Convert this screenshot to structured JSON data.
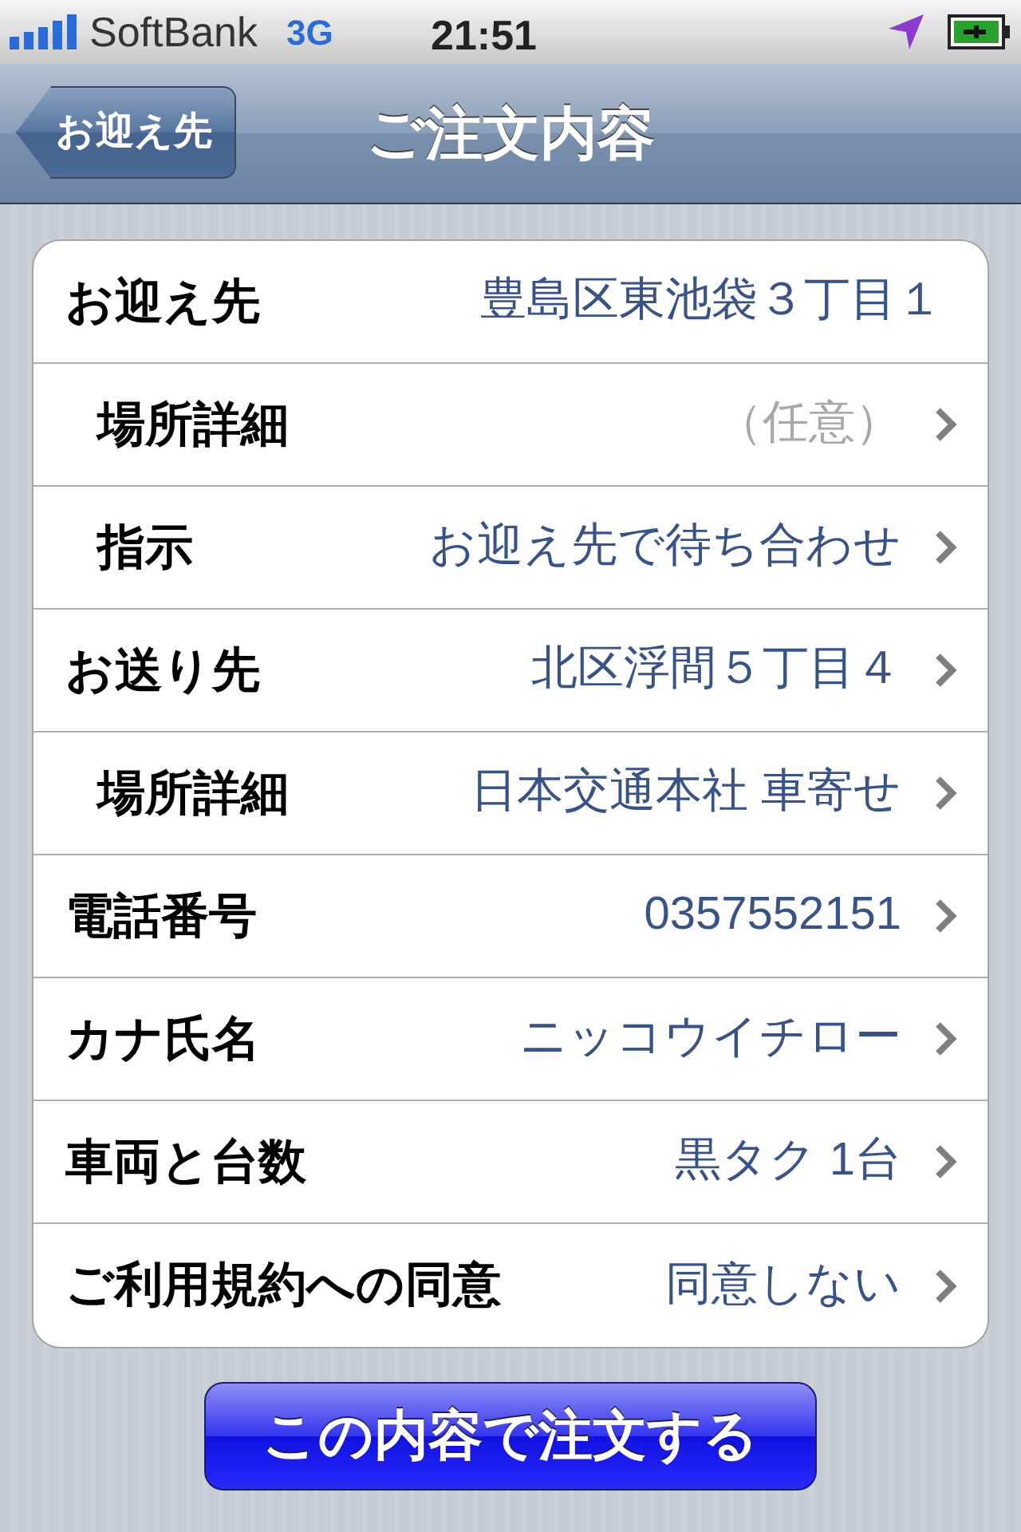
{
  "status_bar": {
    "carrier": "SoftBank",
    "network": "3G",
    "time": "21:51"
  },
  "nav_bar": {
    "back_button": "お迎え先",
    "title": "ご注文内容"
  },
  "rows": [
    {
      "label": "お迎え先",
      "value": "豊島区東池袋３丁目１",
      "indented": false,
      "disclosure": false,
      "placeholder": false
    },
    {
      "label": "場所詳細",
      "value": "（任意）",
      "indented": true,
      "disclosure": true,
      "placeholder": true
    },
    {
      "label": "指示",
      "value": "お迎え先で待ち合わせ",
      "indented": true,
      "disclosure": true,
      "placeholder": false
    },
    {
      "label": "お送り先",
      "value": "北区浮間５丁目４",
      "indented": false,
      "disclosure": true,
      "placeholder": false
    },
    {
      "label": "場所詳細",
      "value": "日本交通本社 車寄せ",
      "indented": true,
      "disclosure": true,
      "placeholder": false
    },
    {
      "label": "電話番号",
      "value": "0357552151",
      "indented": false,
      "disclosure": true,
      "placeholder": false
    },
    {
      "label": "カナ氏名",
      "value": "ニッコウイチロー",
      "indented": false,
      "disclosure": true,
      "placeholder": false
    },
    {
      "label": "車両と台数",
      "value": "黒タク 1台",
      "indented": false,
      "disclosure": true,
      "placeholder": false
    },
    {
      "label": "ご利用規約への同意",
      "value": "同意しない",
      "indented": false,
      "disclosure": true,
      "placeholder": false
    }
  ],
  "submit_button": "この内容で注文する"
}
